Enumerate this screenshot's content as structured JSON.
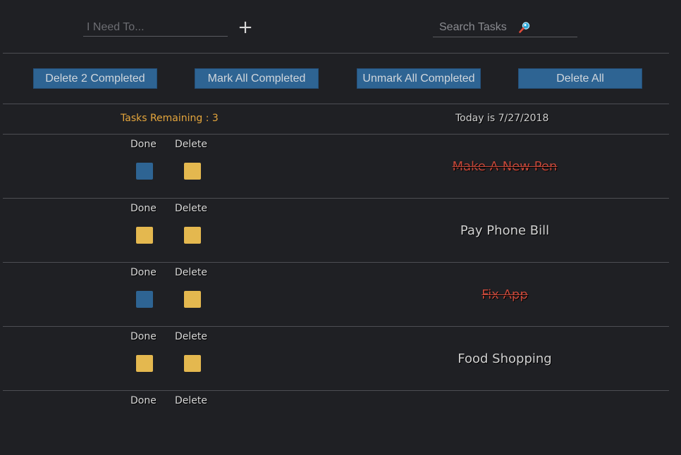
{
  "add_task": {
    "placeholder": "I Need To...",
    "add_label": "+"
  },
  "search": {
    "placeholder": "Search Tasks"
  },
  "actions": {
    "delete_completed": "Delete 2 Completed",
    "mark_all": "Mark All Completed",
    "unmark_all": "Unmark All Completed",
    "delete_all": "Delete All"
  },
  "status": {
    "remaining": "Tasks Remaining : 3",
    "today": "Today is 7/27/2018"
  },
  "column_labels": {
    "done": "Done",
    "delete": "Delete"
  },
  "tasks": [
    {
      "name": "Make A New Pen",
      "completed": true
    },
    {
      "name": "Pay Phone Bill",
      "completed": false
    },
    {
      "name": "Fix App",
      "completed": true
    },
    {
      "name": "Food Shopping",
      "completed": false
    },
    {
      "name": "",
      "completed": false
    }
  ],
  "colors": {
    "background": "#1f2024",
    "button": "#2e6493",
    "checkbox_done": "#2e6493",
    "checkbox_open": "#e4b84f",
    "remaining_text": "#e4a53c",
    "completed_text": "#c5483a"
  }
}
